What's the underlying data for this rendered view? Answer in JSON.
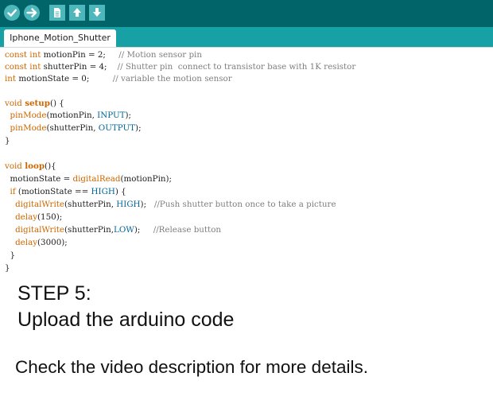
{
  "colors": {
    "toolbar_bg": "#006468",
    "tabbar_bg": "#17a1a5",
    "keyword": "#cc6600",
    "constant": "#006699",
    "comment": "#7e7e7e"
  },
  "toolbar": {
    "buttons": [
      {
        "name": "verify",
        "icon": "checkmark-icon"
      },
      {
        "name": "upload",
        "icon": "arrow-right-icon"
      },
      {
        "name": "new",
        "icon": "new-file-icon"
      },
      {
        "name": "open",
        "icon": "arrow-up-icon"
      },
      {
        "name": "save",
        "icon": "arrow-down-icon"
      }
    ]
  },
  "tab": {
    "label": "Iphone_Motion_Shutter"
  },
  "code": {
    "l1": {
      "a": "const int",
      "b": " motionPin = 2;     ",
      "c": "// Motion sensor pin"
    },
    "l2": {
      "a": "const int",
      "b": " shutterPin = 4;    ",
      "c": "// Shutter pin  connect to transistor base with 1K resistor"
    },
    "l3": {
      "a": "int",
      "b": " motionState = 0;         ",
      "c": "// variable the motion sensor"
    },
    "l5": {
      "a": "void",
      "b": " ",
      "c": "setup",
      "d": "() {"
    },
    "l6": {
      "a": "  ",
      "b": "pinMode",
      "c": "(motionPin, ",
      "d": "INPUT",
      "e": ");"
    },
    "l7": {
      "a": "  ",
      "b": "pinMode",
      "c": "(shutterPin, ",
      "d": "OUTPUT",
      "e": ");"
    },
    "l8": {
      "a": "}"
    },
    "l10": {
      "a": "void",
      "b": " ",
      "c": "loop",
      "d": "(){"
    },
    "l11": {
      "a": "  motionState = ",
      "b": "digitalRead",
      "c": "(motionPin);"
    },
    "l12": {
      "a": "  ",
      "b": "if",
      "c": " (motionState == ",
      "d": "HIGH",
      "e": ") {"
    },
    "l13": {
      "a": "    ",
      "b": "digitalWrite",
      "c": "(shutterPin, ",
      "d": "HIGH",
      "e": ");   ",
      "f": "//Push shutter button once to take a picture"
    },
    "l14": {
      "a": "    ",
      "b": "delay",
      "c": "(150);"
    },
    "l15": {
      "a": "    ",
      "b": "digitalWrite",
      "c": "(shutterPin,",
      "d": "LOW",
      "e": ");     ",
      "f": "//Release button"
    },
    "l16": {
      "a": "    ",
      "b": "delay",
      "c": "(3000);"
    },
    "l17": {
      "a": "  }"
    },
    "l18": {
      "a": "}"
    }
  },
  "caption": {
    "step": "STEP 5:",
    "instruction": "Upload the arduino code",
    "note": "Check the video description for more details."
  }
}
